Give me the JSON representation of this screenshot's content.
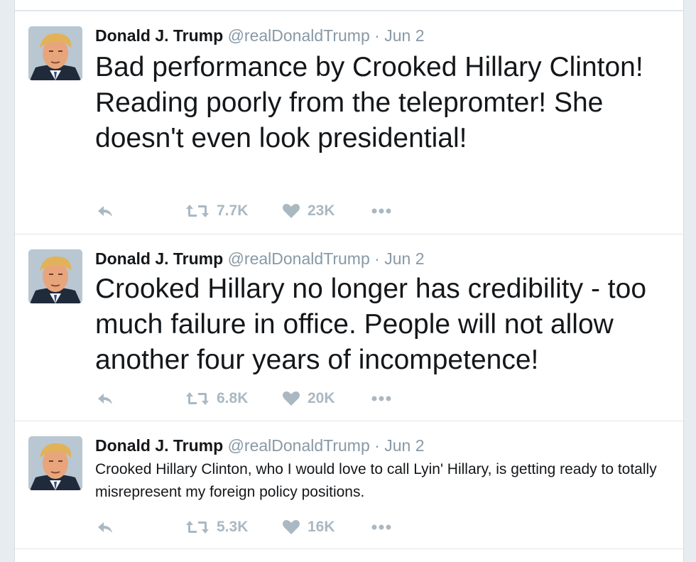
{
  "tweets": [
    {
      "name": "Donald J. Trump",
      "handle": "@realDonaldTrump",
      "separator": "·",
      "time": "Jun 2",
      "text": "Bad performance by Crooked Hillary Clinton! Reading poorly from the telepromter! She doesn't even look presidential!",
      "retweets": "7.7K",
      "likes": "23K"
    },
    {
      "name": "Donald J. Trump",
      "handle": "@realDonaldTrump",
      "separator": "·",
      "time": "Jun 2",
      "text": "Crooked Hillary no longer has credibility - too much failure in office. People will not allow another four years of incompetence!",
      "retweets": "6.8K",
      "likes": "20K"
    },
    {
      "name": "Donald J. Trump",
      "handle": "@realDonaldTrump",
      "separator": "·",
      "time": "Jun 2",
      "text": "Crooked Hillary Clinton, who I would love to call Lyin' Hillary, is getting ready to totally misrepresent my foreign policy positions.",
      "retweets": "5.3K",
      "likes": "16K"
    }
  ],
  "icons": {
    "reply": "reply-icon",
    "retweet": "retweet-icon",
    "like": "heart-icon",
    "more": "more-dots-icon",
    "avatar": "profile-photo"
  },
  "colors": {
    "background": "#e6ecf0",
    "card": "#ffffff",
    "text": "#14171a",
    "muted": "#8899a6",
    "action": "#aab8c2"
  }
}
